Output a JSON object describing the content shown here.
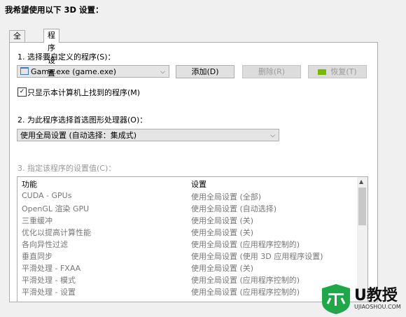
{
  "heading": "我希望使用以下 3D 设置：",
  "tabs": [
    "全局设置",
    "程序设置"
  ],
  "step1": "1. 选择要自定义的程序(S)：",
  "program_value": "Game.exe (game.exe)",
  "buttons": {
    "add": "添加(D)",
    "remove": "删除(R)",
    "restore": "恢复(T)"
  },
  "checkbox_label": "只显示本计算机上找到的程序(M)",
  "step2": "2. 为此程序选择首选图形处理器(O)：",
  "gpu_value": "使用全局设置 (自动选择：集成式)",
  "step3": "3. 指定该程序的设置值(C)：",
  "table": {
    "headers": [
      "功能",
      "设置"
    ],
    "rows": [
      [
        "CUDA - GPUs",
        "使用全局设置 (全部)"
      ],
      [
        "OpenGL 渲染 GPU",
        "使用全局设置 (自动选择)"
      ],
      [
        "三重缓冲",
        "使用全局设置 (关)"
      ],
      [
        "优化以提高计算性能",
        "使用全局设置 (关)"
      ],
      [
        "各向异性过滤",
        "使用全局设置 (应用程序控制的)"
      ],
      [
        "垂直同步",
        "使用全局设置 (使用 3D 应用程序设置)"
      ],
      [
        "平滑处理 - FXAA",
        "使用全局设置 (关)"
      ],
      [
        "平滑处理 - 模式",
        "使用全局设置 (应用程序控制的)"
      ],
      [
        "平滑处理 - 设置",
        "使用全局设置 (应用程序控制的)"
      ]
    ]
  },
  "watermark": {
    "brand": "U教授",
    "url": "UJIAOSHOU.COM"
  }
}
